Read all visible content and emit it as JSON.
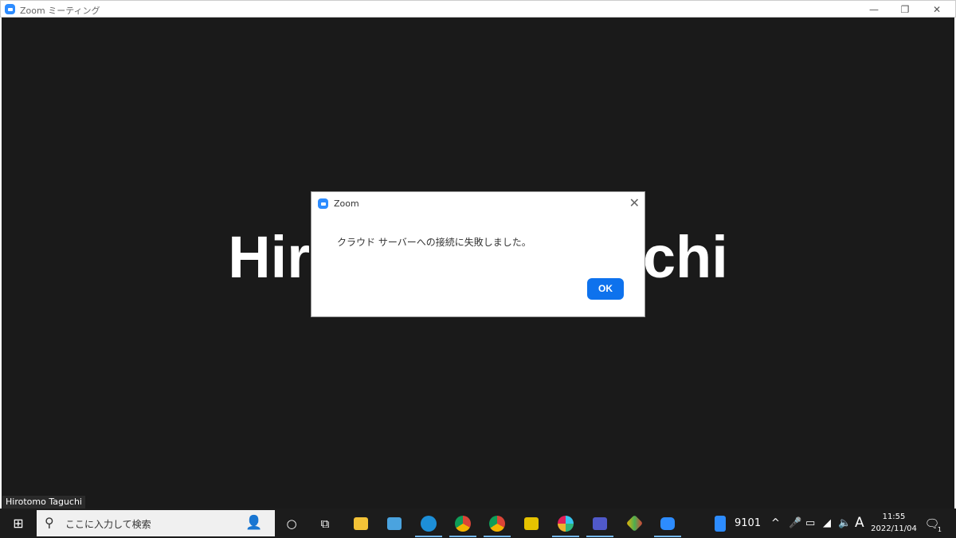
{
  "window": {
    "title": "Zoom ミーティング",
    "minimize": "—",
    "restore": "❐",
    "close": "✕"
  },
  "meeting": {
    "participant_name": "Hirotomo Taguchi",
    "name_tag": "Hirotomo Taguchi"
  },
  "dialog": {
    "title": "Zoom",
    "message": "クラウド サーバーへの接続に失敗しました。",
    "ok_label": "OK",
    "close": "✕"
  },
  "taskbar": {
    "search_placeholder": "ここに入力して検索",
    "tray_app_label": "9101",
    "ime": "A",
    "time": "11:55",
    "date": "2022/11/04",
    "notification_count": "1",
    "apps": [
      "cortana",
      "task-view",
      "file-explorer",
      "app",
      "edge",
      "chrome",
      "chrome-profile",
      "t-app",
      "slack",
      "teams",
      "git",
      "zoom"
    ]
  },
  "colors": {
    "accent": "#0E72ED",
    "zoom_brand": "#2D8CFF",
    "stage": "#1a1a1a",
    "taskbar": "#1c1c1c"
  }
}
